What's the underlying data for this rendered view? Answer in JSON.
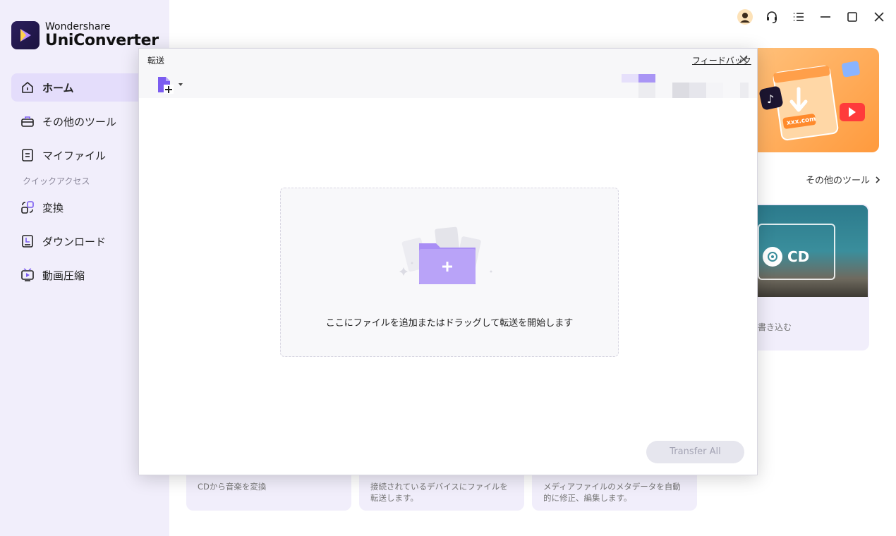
{
  "app": {
    "brand_top": "Wondershare",
    "brand_bottom": "UniConverter"
  },
  "sidebar": {
    "items": [
      {
        "label": "ホーム",
        "icon": "home-icon",
        "active": true
      },
      {
        "label": "その他のツール",
        "icon": "toolbox-icon"
      },
      {
        "label": "マイファイル",
        "icon": "file-icon"
      }
    ],
    "quick_access_label": "クイックアクセス",
    "quick_items": [
      {
        "label": "変換",
        "icon": "convert-icon"
      },
      {
        "label": "ダウンロード",
        "icon": "download-icon"
      },
      {
        "label": "動画圧縮",
        "icon": "compress-icon"
      }
    ]
  },
  "background": {
    "more_tools_label": "その他のツール",
    "banner_url": "xxx.com",
    "cd_label": "CD",
    "cd_desc": "書き込む",
    "bottom_cards": [
      "CDから音楽を変換",
      "接続されているデバイスにファイルを転送します。",
      "メディアファイルのメタデータを自動的に修正、編集します。"
    ]
  },
  "modal": {
    "title": "転送",
    "feedback_label": "フィードバック",
    "drop_text": "ここにファイルを追加またはドラッグして転送を開始します",
    "transfer_all_label": "Transfer All"
  },
  "colors": {
    "accent": "#7b5cf0",
    "sidebar_bg": "#f1eefb",
    "active_bg": "#e4ddfb",
    "banner": "#ffa94d"
  }
}
